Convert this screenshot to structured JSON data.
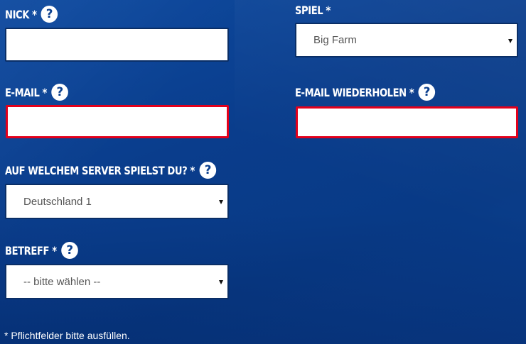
{
  "form": {
    "nick": {
      "label": "NICK *",
      "value": ""
    },
    "spiel": {
      "label": "SPIEL *",
      "selected": "Big Farm"
    },
    "email": {
      "label": "E-MAIL *",
      "value": ""
    },
    "email_repeat": {
      "label": "E-MAIL WIEDERHOLEN *",
      "value": ""
    },
    "server": {
      "label": "AUF WELCHEM SERVER SPIELST DU? *",
      "selected": "Deutschland 1"
    },
    "betreff": {
      "label": "BETREFF *",
      "selected": "-- bitte wählen --"
    },
    "help_glyph": "?",
    "footnote": "* Pflichtfelder bitte ausfüllen."
  },
  "colors": {
    "background": "#0b3f8e",
    "error_border": "#e3001b",
    "field_background": "#ffffff"
  },
  "icons": {
    "help": "question-circle-icon",
    "dropdown": "caret-down-icon"
  }
}
